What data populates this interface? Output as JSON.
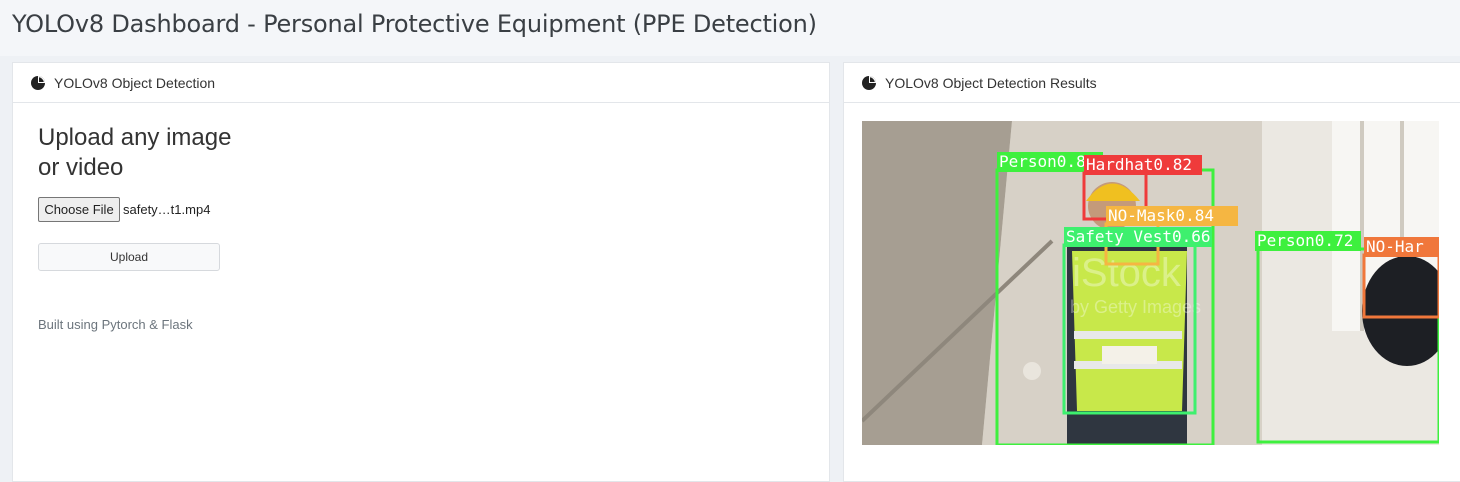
{
  "page": {
    "title": "YOLOv8 Dashboard - Personal Protective Equipment (PPE Detection)"
  },
  "left_card": {
    "title": "YOLOv8 Object Detection",
    "icon": "pie-chart-icon",
    "heading": "Upload any image or video",
    "choose_file_label": "Choose File",
    "file_name": "safety…t1.mp4",
    "upload_label": "Upload",
    "footer": "Built using Pytorch & Flask"
  },
  "right_card": {
    "title": "YOLOv8 Object Detection Results",
    "icon": "pie-chart-icon",
    "detections": [
      {
        "label": "Person0.86",
        "color": "#3ef03e"
      },
      {
        "label": "Hardhat0.82",
        "color": "#ef3b3b"
      },
      {
        "label": "NO-Mask0.84",
        "color": "#f5b642"
      },
      {
        "label": "Safety Vest0.66",
        "color": "#3ef06e"
      },
      {
        "label": "Person0.72",
        "color": "#3ef03e"
      },
      {
        "label": "NO-Har",
        "color": "#f0773b"
      }
    ],
    "watermark": "iStock by Getty Images"
  },
  "colors": {
    "page_bg": "#eef1f5",
    "card_bg": "#ffffff",
    "border": "#e3e6ea"
  }
}
